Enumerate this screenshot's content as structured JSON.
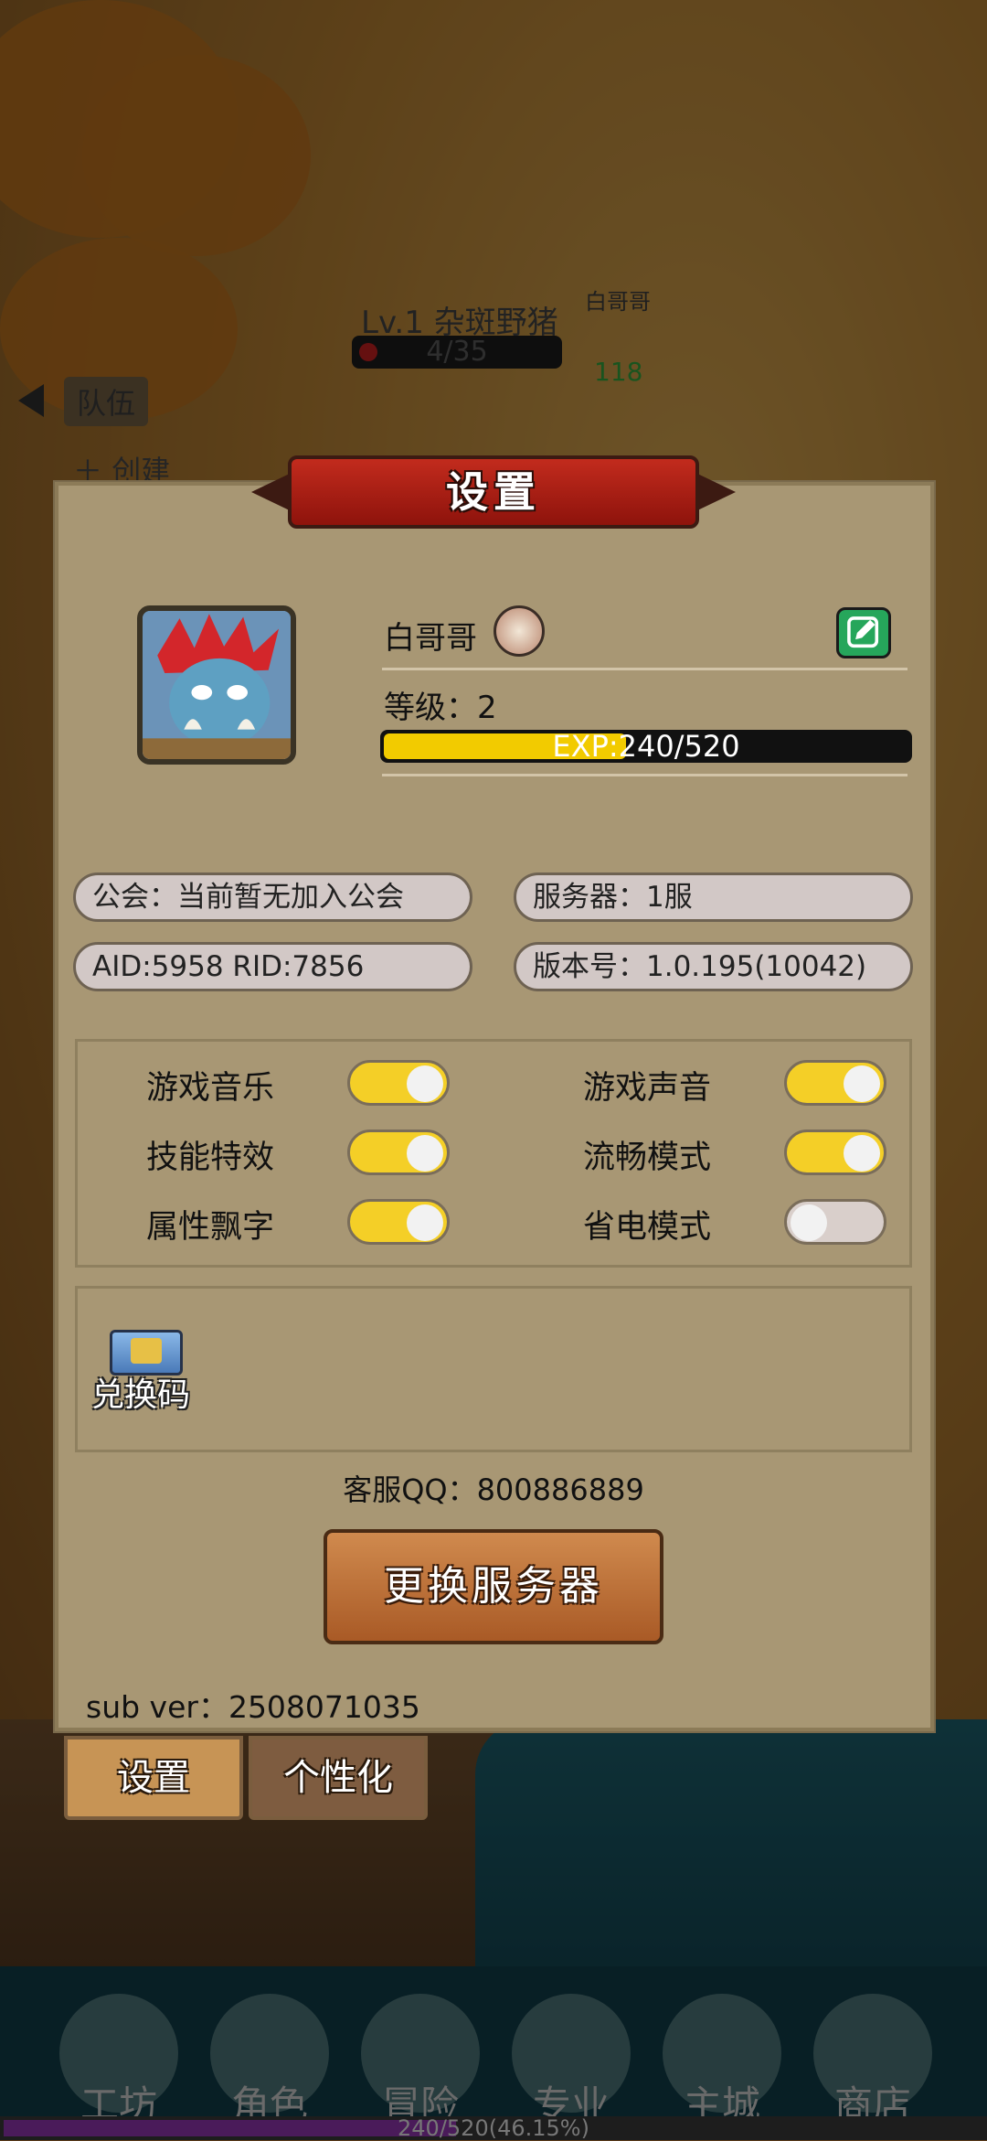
{
  "world": {
    "enemy": {
      "name": "Lv.1 杂斑野猪",
      "hp": "4/35"
    },
    "player_tag": "白哥哥",
    "player_value": "118",
    "team_label": "队伍",
    "create_label": "创建"
  },
  "dialog": {
    "title": "设置",
    "profile": {
      "name": "白哥哥",
      "level_label": "等级：2",
      "exp_text": "EXP:240/520",
      "exp_fraction": 0.4615
    },
    "info": {
      "guild": "公会：当前暂无加入公会",
      "server": "服务器：1服",
      "ids": "AID:5958  RID:7856",
      "version": "版本号：1.0.195(10042)"
    },
    "toggles": [
      {
        "label": "游戏音乐",
        "on": true
      },
      {
        "label": "游戏声音",
        "on": true
      },
      {
        "label": "技能特效",
        "on": true
      },
      {
        "label": "流畅模式",
        "on": true
      },
      {
        "label": "属性飘字",
        "on": true
      },
      {
        "label": "省电模式",
        "on": false
      }
    ],
    "redeem_label": "兑换码",
    "support_qq": "客服QQ：800886889",
    "switch_server_label": "更换服务器",
    "sub_ver": "sub ver：2508071035"
  },
  "tabs": {
    "settings": "设置",
    "personalize": "个性化"
  },
  "nav": [
    "工坊",
    "角色",
    "冒险",
    "专业",
    "主城",
    "商店"
  ],
  "footer_progress": {
    "text": "240/520(46.15%)",
    "fraction": 0.4615
  },
  "colors": {
    "accent_yellow": "#f4cf27",
    "panel": "#a89774",
    "title_red": "#c22b1d",
    "edit_green": "#26a65b"
  }
}
